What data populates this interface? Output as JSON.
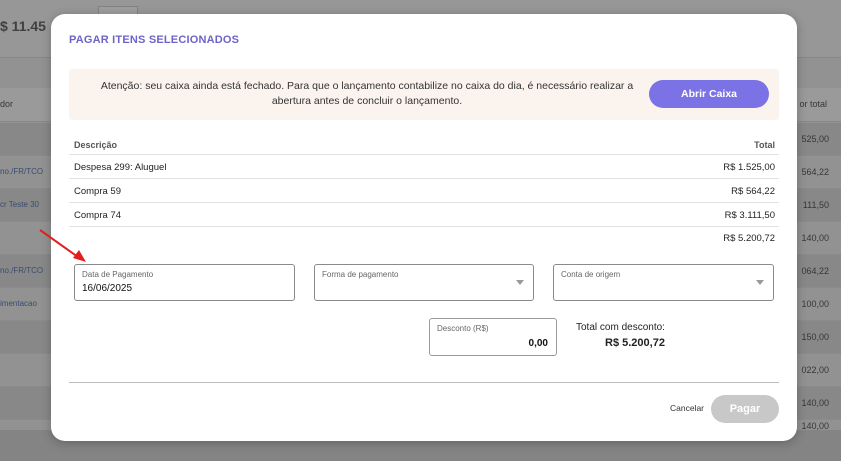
{
  "background": {
    "total_left": "$ 11.45",
    "col_left": "dor",
    "col_right": "or total",
    "row_values": [
      "525,00",
      "564,22",
      "111,50",
      "140,00",
      "064,22",
      "100,00",
      "150,00",
      "022,00",
      "140,00",
      "140,00"
    ],
    "row_links": [
      "",
      "no./FR/TCO",
      "cr Teste 30",
      "",
      "no./FR/TCO",
      "imentacao",
      "",
      "",
      "",
      ""
    ]
  },
  "modal": {
    "title": "PAGAR ITENS SELECIONADOS",
    "alert_text": "Atenção: seu caixa ainda está fechado. Para que o lançamento contabilize no caixa do dia, é necessário realizar a abertura antes de concluir o lançamento.",
    "alert_button": "Abrir Caixa",
    "table": {
      "col_description": "Descrição",
      "col_total": "Total",
      "rows": [
        {
          "description": "Despesa 299: Aluguel",
          "total": "R$ 1.525,00"
        },
        {
          "description": "Compra 59",
          "total": "R$ 564,22"
        },
        {
          "description": "Compra 74",
          "total": "R$ 3.111,50"
        }
      ],
      "grand_total": "R$ 5.200,72"
    },
    "fields": {
      "payment_date_label": "Data de Pagamento",
      "payment_date_value": "16/06/2025",
      "payment_method_label": "Forma de pagamento",
      "source_account_label": "Conta de origem",
      "discount_label": "Desconto (R$)",
      "discount_value": "0,00"
    },
    "total_with_discount_label": "Total com desconto:",
    "total_with_discount_value": "R$ 5.200,72",
    "cancel_label": "Cancelar",
    "pay_label": "Pagar"
  },
  "colors": {
    "accent": "#7b73e5",
    "title": "#6d63c9",
    "alert_bg": "#fbf4ee",
    "disabled_button": "#c8c8c8",
    "arrow": "#e02020"
  }
}
